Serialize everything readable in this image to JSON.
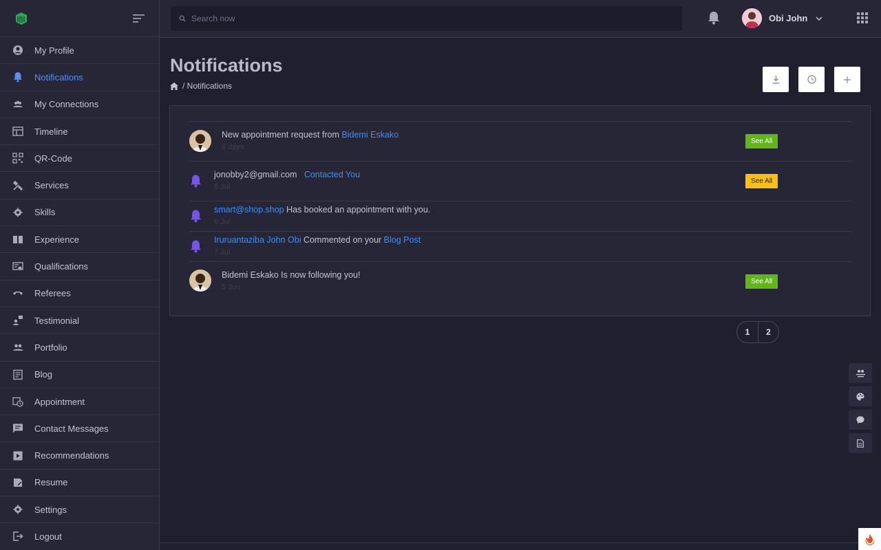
{
  "sidebar": {
    "items": [
      {
        "label": "My Profile",
        "icon": "user-circle-icon"
      },
      {
        "label": "Notifications",
        "icon": "bell-icon",
        "active": true
      },
      {
        "label": "My Connections",
        "icon": "people-icon"
      },
      {
        "label": "Timeline",
        "icon": "timeline-icon"
      },
      {
        "label": "QR-Code",
        "icon": "qr-code-icon"
      },
      {
        "label": "Services",
        "icon": "tools-icon"
      },
      {
        "label": "Skills",
        "icon": "gear-icon"
      },
      {
        "label": "Experience",
        "icon": "book-icon"
      },
      {
        "label": "Qualifications",
        "icon": "certificate-icon"
      },
      {
        "label": "Referees",
        "icon": "phone-icon"
      },
      {
        "label": "Testimonial",
        "icon": "testimonial-icon"
      },
      {
        "label": "Portfolio",
        "icon": "group-icon"
      },
      {
        "label": "Blog",
        "icon": "article-icon"
      },
      {
        "label": "Appointment",
        "icon": "calendar-clock-icon"
      },
      {
        "label": "Contact Messages",
        "icon": "message-icon"
      },
      {
        "label": "Recommendations",
        "icon": "recommend-icon"
      },
      {
        "label": "Resume",
        "icon": "resume-icon"
      },
      {
        "label": "Settings",
        "icon": "settings-icon"
      },
      {
        "label": "Logout",
        "icon": "logout-icon"
      }
    ]
  },
  "header": {
    "search_placeholder": "Search now",
    "user_name": "Obi John"
  },
  "page": {
    "title": "Notifications",
    "breadcrumb_current": "/ Notifications"
  },
  "notifications": [
    {
      "type": "avatar",
      "prefix": "New appointment request from ",
      "link": "Bidemi Eskako",
      "suffix": "",
      "time": "6 days",
      "badge": "See All",
      "badge_color": "green"
    },
    {
      "type": "bell",
      "prefix": "jonobby2@gmail.com   ",
      "link": "Contacted You",
      "suffix": "",
      "time": "5 Jul",
      "badge": "See All",
      "badge_color": "yellow"
    },
    {
      "type": "bell",
      "link_first": "smart@shop.shop",
      "text": " Has booked an appointment with you.",
      "time": "6 Jul"
    },
    {
      "type": "bell",
      "link_first": "Iruruantaziba John Obi",
      "text": " Commented on your ",
      "link_end": "Blog Post",
      "time": "7 Jul"
    },
    {
      "type": "avatar",
      "prefix": "Bidemi Eskako Is now following you!",
      "time": "5 Jun",
      "badge": "See All",
      "badge_color": "green"
    }
  ],
  "pagination": {
    "pages": [
      "1",
      "2"
    ]
  },
  "colors": {
    "accent": "#5b8def",
    "link": "#3d8ef5",
    "bell": "#7b52e8",
    "badge_green": "#63b51c",
    "badge_yellow": "#fbbd18",
    "logo": "#2fa45b"
  }
}
